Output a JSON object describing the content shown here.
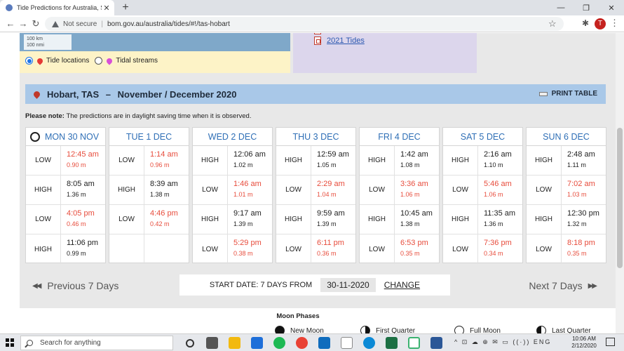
{
  "browser": {
    "tab_title": "Tide Predictions for Australia, So",
    "tab_close": "✕",
    "new_tab": "+",
    "minimize": "—",
    "maximize": "❐",
    "close": "✕",
    "back": "←",
    "forward": "→",
    "reload": "↻",
    "security": "Not secure",
    "separator": "|",
    "url": "bom.gov.au/australia/tides/#!/tas-hobart",
    "bookmark": "☆",
    "extensions": "✱",
    "profile_initial": "T",
    "menu": "⋮"
  },
  "map": {
    "scale_km": "100 km",
    "scale_nmi": "100 nmi",
    "tide_locations_label": "Tide locations",
    "tidal_streams_label": "Tidal streams",
    "tide_pin_color": "#e53935",
    "stream_pin_color": "#d84fd8"
  },
  "links": {
    "tides_2021": "2021 Tides"
  },
  "header": {
    "location": "Hobart, TAS",
    "dash": "–",
    "period": "November / December 2020",
    "print_label": "PRINT TABLE"
  },
  "note": {
    "label": "Please note:",
    "text": "The predictions are in daylight saving time when it is observed."
  },
  "days": [
    {
      "label": "MON 30 NOV",
      "tides": [
        {
          "type": "LOW",
          "time": "12:45 am",
          "height": "0.90 m"
        },
        {
          "type": "HIGH",
          "time": "8:05 am",
          "height": "1.36 m"
        },
        {
          "type": "LOW",
          "time": "4:05 pm",
          "height": "0.46 m"
        },
        {
          "type": "HIGH",
          "time": "11:06 pm",
          "height": "0.99 m"
        }
      ]
    },
    {
      "label": "TUE 1 DEC",
      "tides": [
        {
          "type": "LOW",
          "time": "1:14 am",
          "height": "0.96 m"
        },
        {
          "type": "HIGH",
          "time": "8:39 am",
          "height": "1.38 m"
        },
        {
          "type": "LOW",
          "time": "4:46 pm",
          "height": "0.42 m"
        },
        {
          "type": "",
          "time": "",
          "height": ""
        }
      ]
    },
    {
      "label": "WED 2 DEC",
      "tides": [
        {
          "type": "HIGH",
          "time": "12:06 am",
          "height": "1.02 m"
        },
        {
          "type": "LOW",
          "time": "1:46 am",
          "height": "1.01 m"
        },
        {
          "type": "HIGH",
          "time": "9:17 am",
          "height": "1.39 m"
        },
        {
          "type": "LOW",
          "time": "5:29 pm",
          "height": "0.38 m"
        }
      ]
    },
    {
      "label": "THU 3 DEC",
      "tides": [
        {
          "type": "HIGH",
          "time": "12:59 am",
          "height": "1.05 m"
        },
        {
          "type": "LOW",
          "time": "2:29 am",
          "height": "1.04 m"
        },
        {
          "type": "HIGH",
          "time": "9:59 am",
          "height": "1.39 m"
        },
        {
          "type": "LOW",
          "time": "6:11 pm",
          "height": "0.36 m"
        }
      ]
    },
    {
      "label": "FRI 4 DEC",
      "tides": [
        {
          "type": "HIGH",
          "time": "1:42 am",
          "height": "1.08 m"
        },
        {
          "type": "LOW",
          "time": "3:36 am",
          "height": "1.06 m"
        },
        {
          "type": "HIGH",
          "time": "10:45 am",
          "height": "1.38 m"
        },
        {
          "type": "LOW",
          "time": "6:53 pm",
          "height": "0.35 m"
        }
      ]
    },
    {
      "label": "SAT 5 DEC",
      "tides": [
        {
          "type": "HIGH",
          "time": "2:16 am",
          "height": "1.10 m"
        },
        {
          "type": "LOW",
          "time": "5:46 am",
          "height": "1.06 m"
        },
        {
          "type": "HIGH",
          "time": "11:35 am",
          "height": "1.36 m"
        },
        {
          "type": "LOW",
          "time": "7:36 pm",
          "height": "0.34 m"
        }
      ]
    },
    {
      "label": "SUN 6 DEC",
      "tides": [
        {
          "type": "HIGH",
          "time": "2:48 am",
          "height": "1.11 m"
        },
        {
          "type": "LOW",
          "time": "7:02 am",
          "height": "1.03 m"
        },
        {
          "type": "HIGH",
          "time": "12:30 pm",
          "height": "1.32 m"
        },
        {
          "type": "LOW",
          "time": "8:18 pm",
          "height": "0.35 m"
        }
      ]
    }
  ],
  "colors": {
    "high": "#222222",
    "low": "#e74c3c",
    "day_header": "#2f6fb6"
  },
  "navigation": {
    "prev_arrow": "▶▶",
    "prev_label": "Previous 7 Days",
    "next_label": "Next 7 Days",
    "next_arrow": "▶▶",
    "start_label": "START DATE: 7 DAYS FROM",
    "start_date": "30-11-2020",
    "change_label": "CHANGE"
  },
  "moon": {
    "title": "Moon Phases",
    "new": "New Moon",
    "first": "First Quarter",
    "full": "Full Moon",
    "last": "Last Quarter"
  },
  "taskbar": {
    "search_placeholder": "Search for anything",
    "tray_icons": "^ ⊡ ☁ ⊕ ✉ ▭ ((·)) ENG",
    "time": "10:06 AM",
    "date": "2/12/2020"
  }
}
